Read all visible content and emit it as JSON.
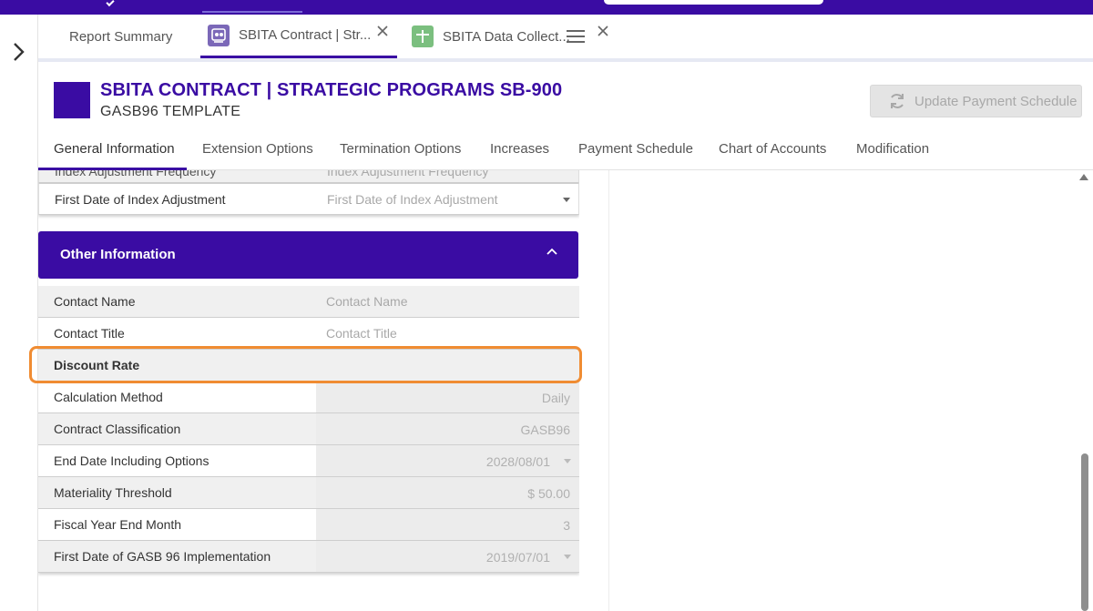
{
  "tabs": [
    {
      "label": "Report Summary"
    },
    {
      "label": "SBITA Contract | Str...",
      "icon": "contract-icon"
    },
    {
      "label": "SBITA Data Collect...",
      "icon": "table-icon"
    }
  ],
  "header": {
    "title": "SBITA CONTRACT | STRATEGIC PROGRAMS SB-900",
    "subtitle": "GASB96 TEMPLATE",
    "update_button": "Update Payment Schedule"
  },
  "section_tabs": [
    "General Information",
    "Extension Options",
    "Termination Options",
    "Increases",
    "Payment Schedule",
    "Chart of Accounts",
    "Modification"
  ],
  "form": {
    "cutoff_row": {
      "label": "Index Adjustment Frequency",
      "placeholder": "Index Adjustment Frequency"
    },
    "index_adjustment": {
      "label": "First Date of Index Adjustment",
      "placeholder": "First Date of Index Adjustment"
    },
    "other_information": {
      "title": "Other Information",
      "contact_name": {
        "label": "Contact Name",
        "placeholder": "Contact Name"
      },
      "contact_title": {
        "label": "Contact Title",
        "placeholder": "Contact Title"
      },
      "discount_rate": {
        "label": "Discount Rate"
      },
      "rows": [
        {
          "label": "Calculation Method",
          "value": "Daily"
        },
        {
          "label": "Contract Classification",
          "value": "GASB96"
        },
        {
          "label": "End Date Including Options",
          "value": "2028/08/01"
        },
        {
          "label": "Materiality Threshold",
          "value": "$ 50.00"
        },
        {
          "label": "Fiscal Year End Month",
          "value": "3"
        },
        {
          "label": "First Date of GASB 96 Implementation",
          "value": "2019/07/01"
        }
      ]
    }
  },
  "colors": {
    "brand": "#3a0ca3",
    "highlight": "#f08c32"
  }
}
